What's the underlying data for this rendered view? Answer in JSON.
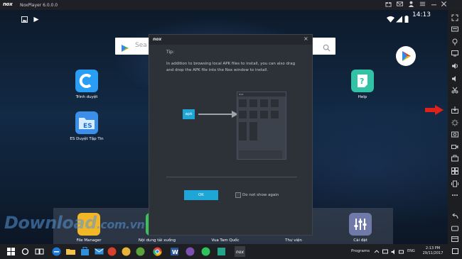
{
  "window": {
    "title": "NoxPlayer 6.0.0.0",
    "logo_text": "nox"
  },
  "status_bar": {
    "time": "14:13"
  },
  "home": {
    "search_hint": "Sea",
    "apps": [
      {
        "label": "Trình duyệt"
      },
      {
        "label": "ES Duyệt Tập Tin"
      },
      {
        "label": "Help"
      }
    ],
    "dock": [
      {
        "label": "File Manager"
      },
      {
        "label": "Nội dung tải xuống"
      },
      {
        "label": "Vua Tam Quốc"
      },
      {
        "label": "Thư viện"
      },
      {
        "label": "Cài đặt"
      }
    ]
  },
  "dialog": {
    "logo_text": "nox",
    "close_label": "×",
    "tip_title": "Tip:",
    "tip_body": "In addition to browsing local APK files to install, you can also drag and drop the APK file into the Nox window to install.",
    "apk_label": "apk",
    "mini_window_logo": "nox",
    "ok_label": "OK",
    "checkbox_label": "Do not show again"
  },
  "taskbar": {
    "programs_label": "Programs",
    "language": "ENG",
    "clock_time": "2:13 PM",
    "clock_date": "29/11/2017"
  },
  "watermark": {
    "text": "Download",
    "suffix": ".com.vn"
  },
  "colors": {
    "accent": "#1ea6d6",
    "highlight_arrow": "#e0201a"
  }
}
